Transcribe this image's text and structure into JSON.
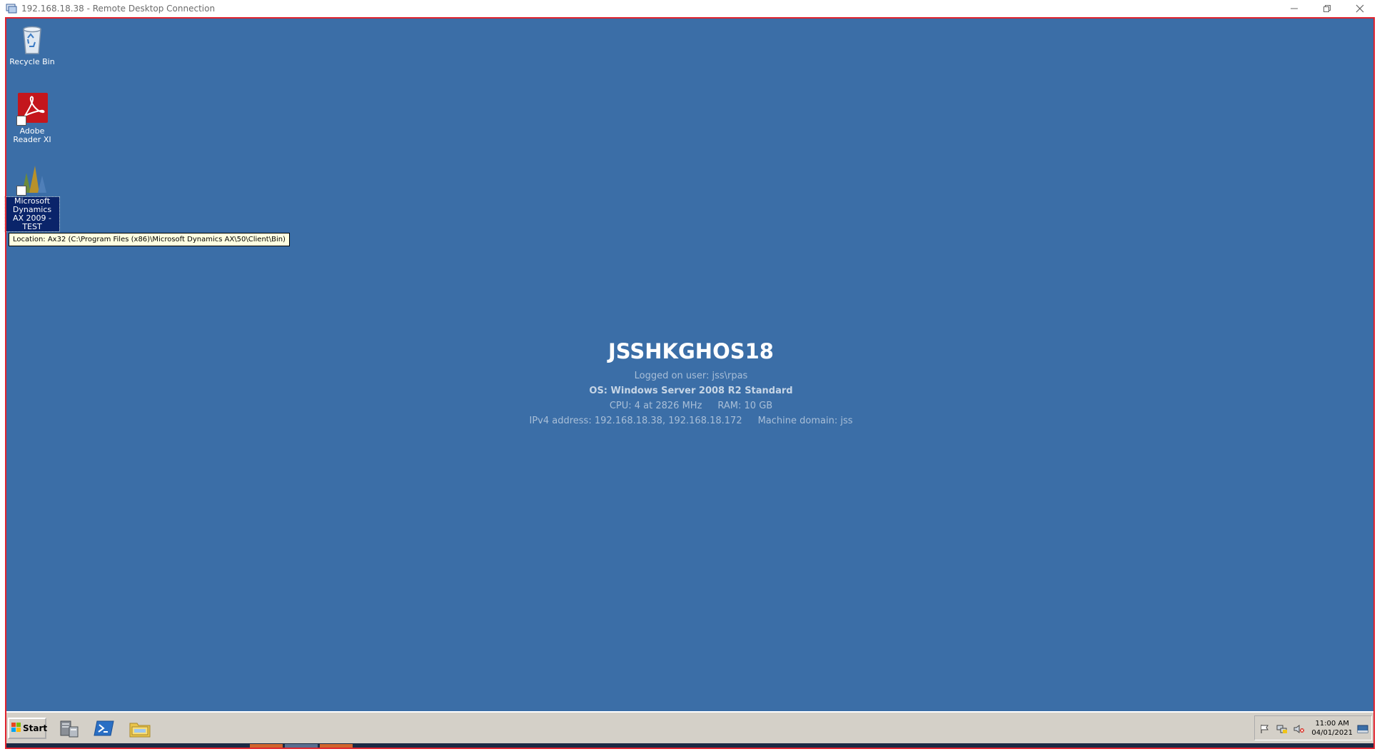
{
  "window": {
    "title": "192.168.18.38 - Remote Desktop Connection"
  },
  "desktop": {
    "icons": [
      {
        "label": "Recycle Bin",
        "icon": "recycle-bin-icon"
      },
      {
        "label": "Adobe Reader XI",
        "icon": "adobe-reader-icon"
      },
      {
        "label": "Microsoft Dynamics AX 2009 - TEST",
        "icon": "dynamics-ax-icon",
        "selected": true
      }
    ],
    "tooltip": "Location: Ax32 (C:\\Program Files (x86)\\Microsoft Dynamics AX\\50\\Client\\Bin)"
  },
  "bginfo": {
    "hostname": "JSSHKGHOS18",
    "logged_on_user": "Logged on user: jss\\rpas",
    "os": "OS: Windows Server 2008 R2 Standard",
    "cpu": "CPU: 4 at 2826 MHz",
    "ram": "RAM: 10  GB",
    "ipv4": "IPv4 address: 192.168.18.38, 192.168.18.172",
    "domain": "Machine domain: jss"
  },
  "taskbar": {
    "start_label": "Start",
    "pinned": [
      "server-manager-icon",
      "powershell-icon",
      "explorer-icon"
    ],
    "clock_time": "11:00 AM",
    "clock_date": "04/01/2021",
    "tray_icons": [
      "action-center-flag-icon",
      "network-icon",
      "volume-muted-icon",
      "show-desktop-icon"
    ]
  },
  "colors": {
    "desktop_bg": "#3b6ea7",
    "frame_border": "#e0232e",
    "taskbar": "#d4d0c8"
  }
}
